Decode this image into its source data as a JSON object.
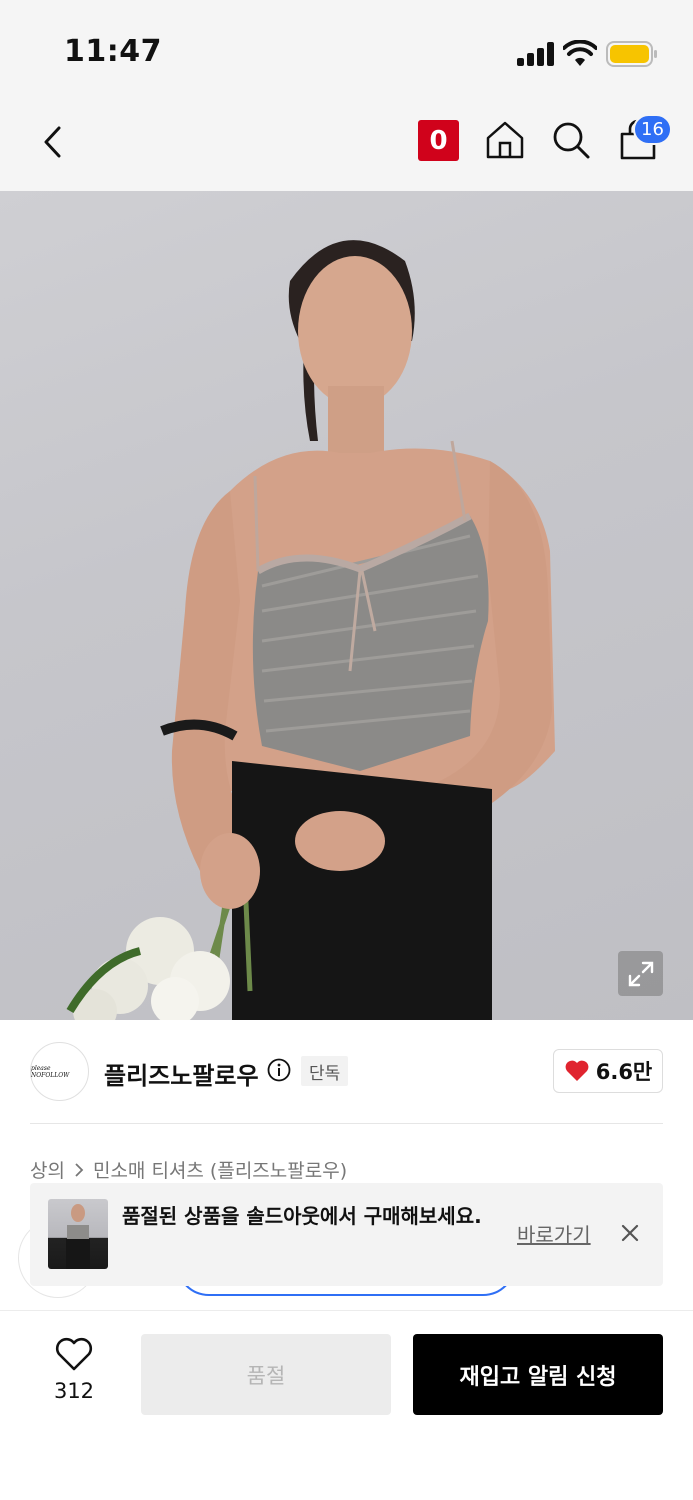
{
  "status_bar": {
    "time": "11:47"
  },
  "header": {
    "brand_badge": "0",
    "cart_count": "16",
    "icons": [
      "chevron-left-icon",
      "home-icon",
      "search-icon",
      "shopping-bag-icon"
    ],
    "accent_color": "#d0021b",
    "badge_color": "#2f6ff5"
  },
  "brand": {
    "name": "플리즈노팔로우",
    "tag": "단독",
    "likes": "6.6만",
    "logo_text": "please NOFOLLOW"
  },
  "breadcrumb": {
    "category": "상의",
    "subcategory": "민소매 티셔츠 (플리즈노팔로우)"
  },
  "toast": {
    "message": "품절된 상품을 솔드아웃에서 구매해보세요.",
    "link": "바로가기"
  },
  "bottom_bar": {
    "wish_count": "312",
    "soldout_label": "품절",
    "restock_label": "재입고 알림 신청"
  }
}
